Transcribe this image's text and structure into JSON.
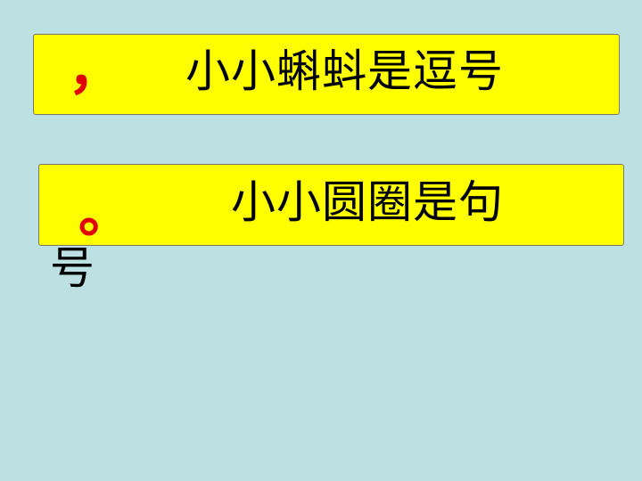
{
  "cards": [
    {
      "mark": "，",
      "text": "小小蝌蚪是逗号"
    },
    {
      "mark": "。",
      "text": "小小圆圈是句"
    }
  ],
  "overflow_text": "号",
  "colors": {
    "background": "#bde0e3",
    "card_fill": "#ffff00",
    "mark_color": "#e00000",
    "text_color": "#000000"
  }
}
